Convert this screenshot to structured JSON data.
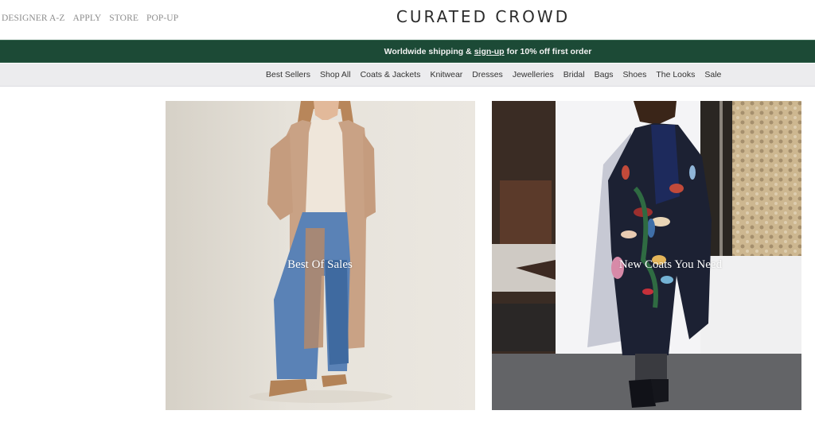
{
  "header": {
    "utility_links": [
      {
        "label": "DESIGNER A-Z"
      },
      {
        "label": "APPLY"
      },
      {
        "label": "STORE"
      },
      {
        "label": "POP-UP"
      }
    ],
    "logo": "CURATED CROWD"
  },
  "promo": {
    "text_before": "Worldwide shipping &",
    "link_label": "sign-up",
    "text_after": "for 10% off first order",
    "background_color": "#1c4a36"
  },
  "nav": {
    "items": [
      {
        "label": "Best Sellers"
      },
      {
        "label": "Shop All"
      },
      {
        "label": "Coats & Jackets"
      },
      {
        "label": "Knitwear"
      },
      {
        "label": "Dresses"
      },
      {
        "label": "Jewelleries"
      },
      {
        "label": "Bridal"
      },
      {
        "label": "Bags"
      },
      {
        "label": "Shoes"
      },
      {
        "label": "The Looks"
      },
      {
        "label": "Sale"
      }
    ]
  },
  "banners": [
    {
      "label": "Best Of Sales",
      "image": "model-camel-cardigan-wide-jeans-photo"
    },
    {
      "label": "New Coats You Need",
      "image": "model-embroidered-navy-coat-street-photo"
    }
  ]
}
